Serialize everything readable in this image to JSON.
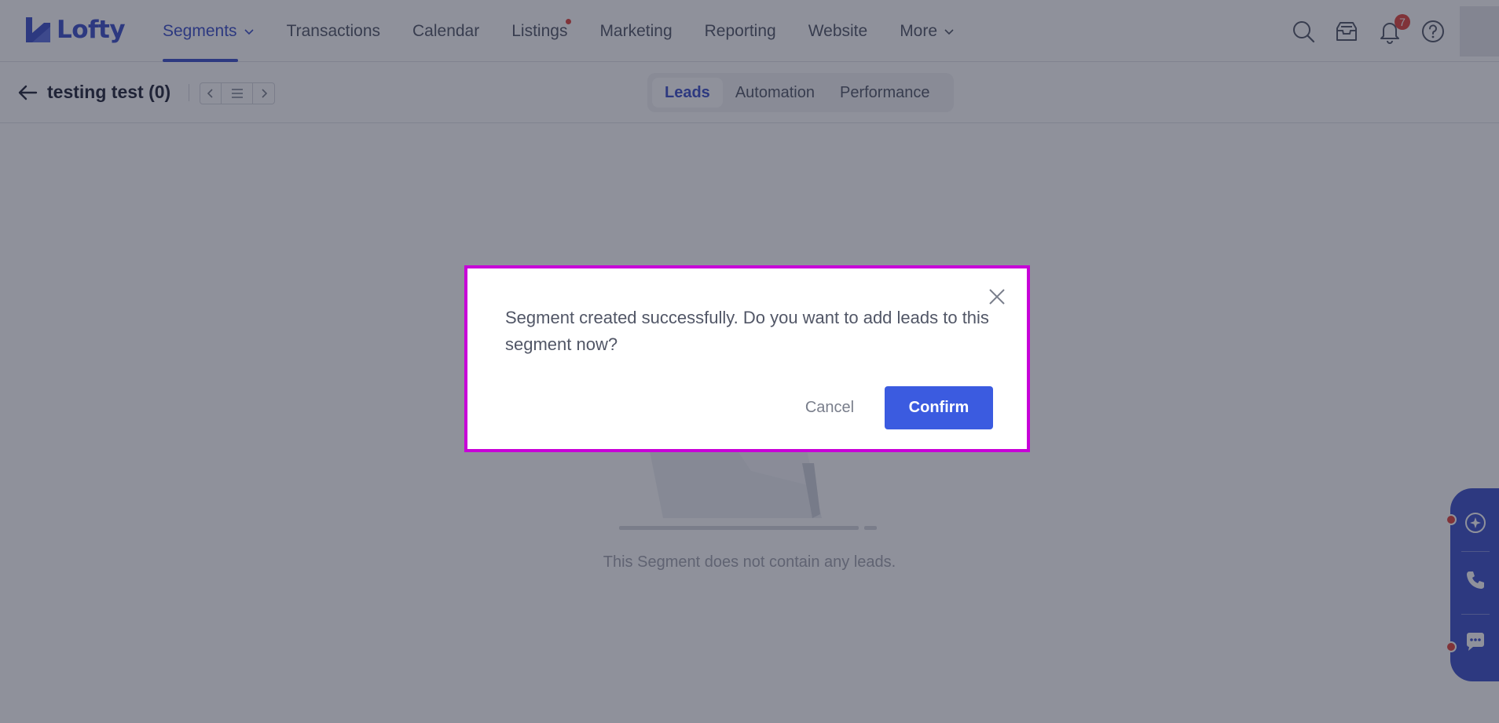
{
  "brand": {
    "name": "Lofty",
    "color": "#3b4ec8"
  },
  "nav": {
    "items": [
      {
        "label": "Segments",
        "active": true,
        "dropdown": true
      },
      {
        "label": "Transactions"
      },
      {
        "label": "Calendar"
      },
      {
        "label": "Listings",
        "dot": true
      },
      {
        "label": "Marketing"
      },
      {
        "label": "Reporting"
      },
      {
        "label": "Website"
      },
      {
        "label": "More",
        "dropdown": true
      }
    ],
    "icons": [
      "search-icon",
      "inbox-icon",
      "bell-icon",
      "help-icon"
    ],
    "notification_count": "7"
  },
  "segment": {
    "title": "testing test (0)",
    "tabs": [
      {
        "label": "Leads",
        "active": true
      },
      {
        "label": "Automation"
      },
      {
        "label": "Performance"
      }
    ],
    "empty_message": "This Segment does not contain any leads."
  },
  "side_widget": {
    "icons": [
      "ai-assistant-icon",
      "phone-icon",
      "chat-icon"
    ]
  },
  "dialog": {
    "message": "Segment created successfully. Do you want to add leads to this segment now?",
    "cancel_label": "Cancel",
    "confirm_label": "Confirm"
  },
  "colors": {
    "accent": "#3b4ec8",
    "confirm": "#3b5be0",
    "highlight": "#c800d8",
    "alert": "#e0423a"
  }
}
